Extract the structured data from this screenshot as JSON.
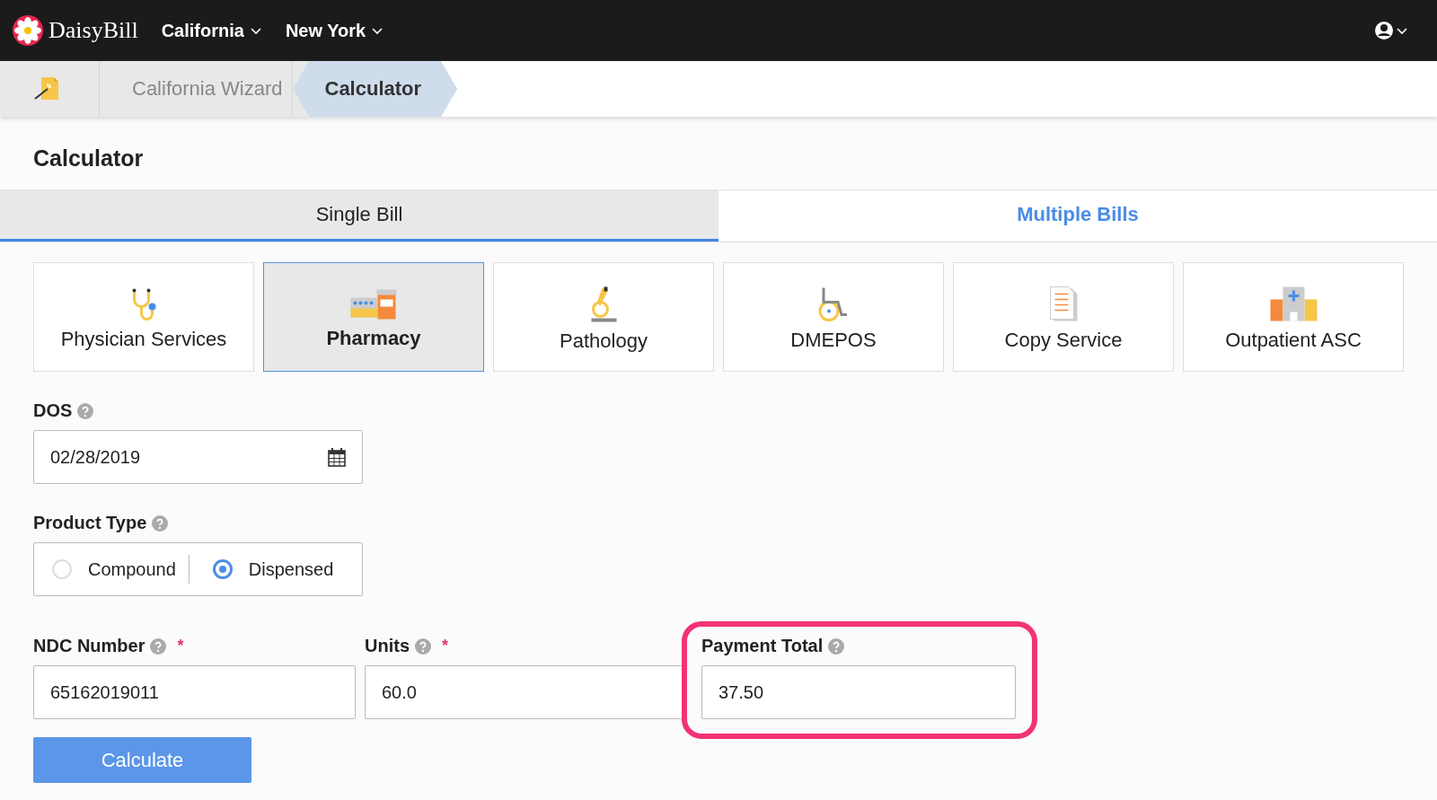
{
  "navbar": {
    "brand": "DaisyBill",
    "menus": [
      {
        "label": "California"
      },
      {
        "label": "New York"
      }
    ]
  },
  "breadcrumbs": [
    {
      "label": "California Wizard",
      "selected": false
    },
    {
      "label": "Calculator",
      "selected": true
    }
  ],
  "page_title": "Calculator",
  "tabs": [
    {
      "label": "Single Bill",
      "selected": true
    },
    {
      "label": "Multiple Bills",
      "selected": false
    }
  ],
  "categories": [
    {
      "label": "Physician Services",
      "kind": "stethoscope",
      "selected": false
    },
    {
      "label": "Pharmacy",
      "kind": "pharmacy",
      "selected": true
    },
    {
      "label": "Pathology",
      "kind": "microscope",
      "selected": false
    },
    {
      "label": "DMEPOS",
      "kind": "wheelchair",
      "selected": false
    },
    {
      "label": "Copy Service",
      "kind": "document",
      "selected": false
    },
    {
      "label": "Outpatient ASC",
      "kind": "hospital",
      "selected": false
    }
  ],
  "dos": {
    "label": "DOS",
    "value": "02/28/2019"
  },
  "product_type": {
    "label": "Product Type",
    "options": [
      {
        "label": "Compound",
        "selected": false
      },
      {
        "label": "Dispensed",
        "selected": true
      }
    ]
  },
  "fields": [
    {
      "label": "NDC Number",
      "required": true,
      "value": "65162019011",
      "highlighted": false
    },
    {
      "label": "Units",
      "required": true,
      "value": "60.0",
      "highlighted": false
    },
    {
      "label": "Payment Total",
      "required": false,
      "value": "37.50",
      "highlighted": true
    }
  ],
  "required_mark": "*",
  "calculate_button": "Calculate"
}
